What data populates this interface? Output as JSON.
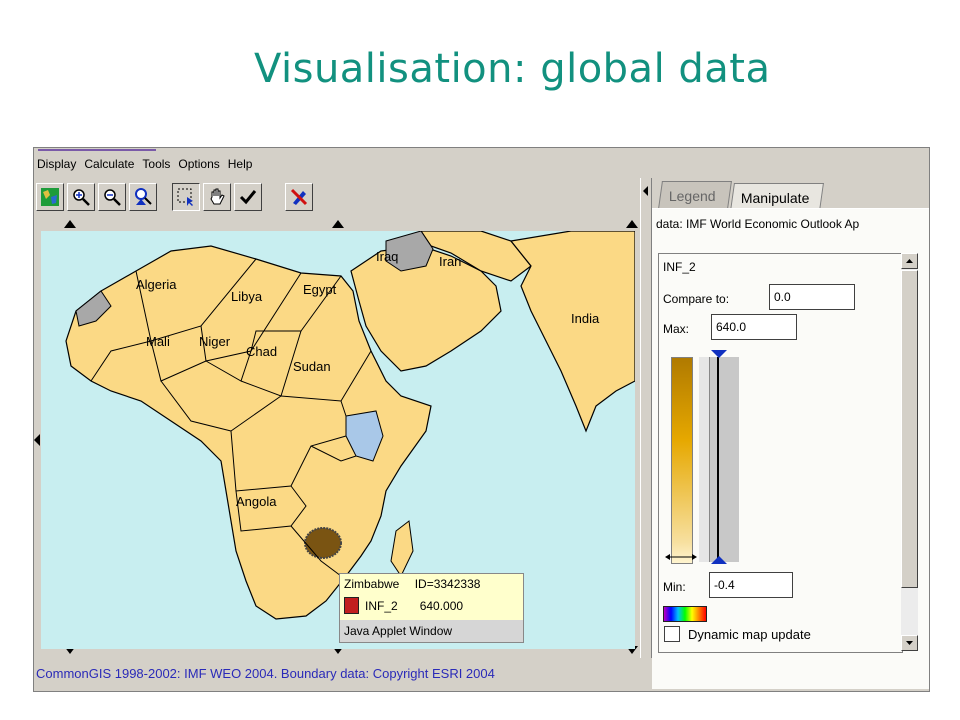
{
  "slide": {
    "title": "Visualisation: global data"
  },
  "menu": {
    "items": [
      "Display",
      "Calculate",
      "Tools",
      "Options",
      "Help"
    ]
  },
  "toolbar": {
    "buttons": [
      "map-icon",
      "zoom-in-icon",
      "zoom-out-icon",
      "find-icon",
      "select-rectangle-icon",
      "hand-pan-icon",
      "checkmark-icon",
      "close-tool-icon"
    ]
  },
  "map": {
    "countries": [
      "Algeria",
      "Libya",
      "Egypt",
      "Iraq",
      "Iran",
      "Mali",
      "Niger",
      "Chad",
      "Sudan",
      "India",
      "Angola"
    ],
    "colors": {
      "sea": "#c8eef0",
      "land": "#fbd985",
      "nodata": "#a8a8a8",
      "highlight": "#a9c8e8",
      "selected": "#7a5412"
    }
  },
  "tooltip": {
    "country": "Zimbabwe",
    "id": "ID=3342338",
    "attr": "INF_2",
    "value": "640.000",
    "footer": "Java Applet Window"
  },
  "status": {
    "text": "CommonGIS 1998-2002: IMF WEO 2004. Boundary data: Copyright ESRI 2004"
  },
  "panel": {
    "tabs": {
      "legend": "Legend",
      "manipulate": "Manipulate"
    },
    "data_line": "data: IMF World Economic Outlook Ap",
    "attribute": "INF_2",
    "compare_label": "Compare to:",
    "compare_value": "0.0",
    "max_label": "Max:",
    "max_value": "640.0",
    "min_label": "Min:",
    "min_value": "-0.4",
    "dynamic_label": "Dynamic map update",
    "dynamic_checked": false
  }
}
